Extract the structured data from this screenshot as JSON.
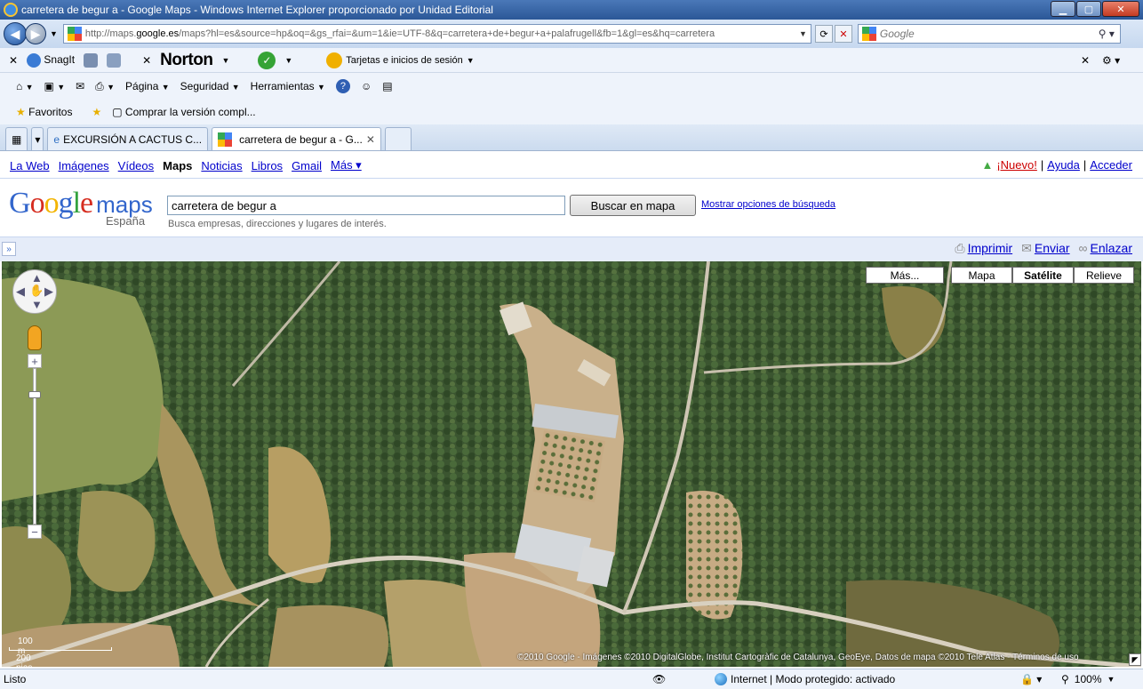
{
  "window": {
    "title": "carretera de begur a - Google Maps - Windows Internet Explorer proporcionado por Unidad Editorial"
  },
  "addressbar": {
    "url_prefix": "http://maps.",
    "url_domain": "google.es",
    "url_rest": "/maps?hl=es&source=hp&oq=&gs_rfai=&um=1&ie=UTF-8&q=carretera+de+begur+a+palafrugell&fb=1&gl=es&hq=carretera",
    "search_placeholder": "Google"
  },
  "toolbar1": {
    "snagit": "SnagIt",
    "norton": "Norton",
    "tarjetas": "Tarjetas e inicios de sesión"
  },
  "toolbar2": {
    "pagina": "Página",
    "seguridad": "Seguridad",
    "herramientas": "Herramientas"
  },
  "favorites": {
    "favoritos": "Favoritos",
    "comprar": "Comprar la versión compl..."
  },
  "tabs": [
    {
      "label": "EXCURSIÓN A CACTUS C..."
    },
    {
      "label": "carretera de begur a - G..."
    }
  ],
  "google_nav": {
    "links": [
      "La Web",
      "Imágenes",
      "Vídeos",
      "Maps",
      "Noticias",
      "Libros",
      "Gmail",
      "Más ▾"
    ],
    "nuevo": "¡Nuevo!",
    "ayuda": "Ayuda",
    "acceder": "Acceder"
  },
  "search": {
    "logo_google": "Google",
    "logo_maps": "maps",
    "logo_country": "España",
    "query": "carretera de begur a",
    "button": "Buscar en mapa",
    "options_link": "Mostrar opciones de búsqueda",
    "hint": "Busca empresas, direcciones y lugares de interés."
  },
  "mapbar": {
    "collapse": "»",
    "imprimir": "Imprimir",
    "enviar": "Enviar",
    "enlazar": "Enlazar"
  },
  "map": {
    "mas": "Más...",
    "mapa": "Mapa",
    "satelite": "Satélite",
    "relieve": "Relieve",
    "scale_m": "100 m",
    "scale_ft": "200 pies",
    "copyright": "©2010 Google - Imágenes ©2010 DigitalGlobe, Institut Cartogràfic de Catalunya, GeoEye, Datos de mapa ©2010 Tele Atlas - Términos de uso"
  },
  "status": {
    "left": "Listo",
    "zone": "Internet | Modo protegido: activado",
    "zoom": "100%"
  }
}
